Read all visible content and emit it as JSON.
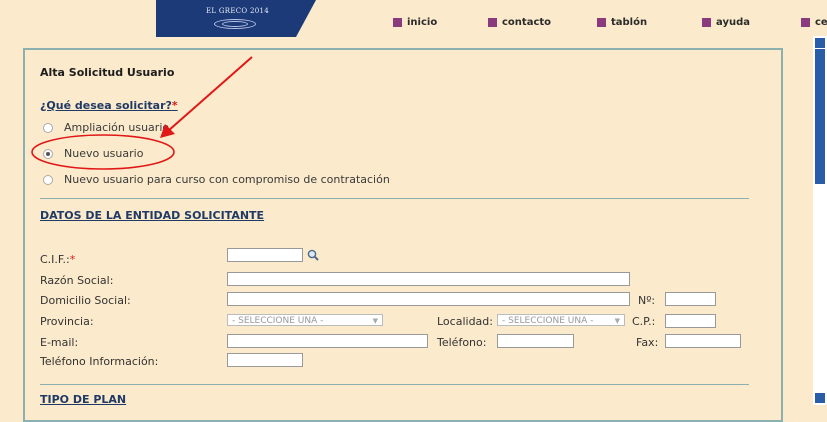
{
  "logo": {
    "text": "EL GRECO 2014"
  },
  "nav": {
    "items": [
      {
        "label": "inicio"
      },
      {
        "label": "contacto"
      },
      {
        "label": "tablón"
      },
      {
        "label": "ayuda"
      },
      {
        "label": "ce"
      }
    ]
  },
  "form": {
    "title": "Alta Solicitud Usuario",
    "question": "¿Qué desea solicitar?",
    "required_mark": "*",
    "options": [
      {
        "label": "Ampliación usuario",
        "selected": false
      },
      {
        "label": "Nuevo usuario",
        "selected": true
      },
      {
        "label": "Nuevo usuario para curso con compromiso de contratación",
        "selected": false
      }
    ],
    "section_entity": "DATOS DE LA ENTIDAD SOLICITANTE",
    "fields": {
      "cif": "C.I.F.:",
      "razon": "Razón Social:",
      "domicilio": "Domicilio Social:",
      "numero": "Nº:",
      "provincia": "Provincia:",
      "provincia_value": "- SELECCIONE UNA -",
      "localidad": "Localidad:",
      "localidad_value": "- SELECCIONE UNA -",
      "cp": "C.P.:",
      "email": "E-mail:",
      "telefono": "Teléfono:",
      "fax": "Fax:",
      "telefono_info": "Teléfono Información:"
    },
    "section_plan": "TIPO DE PLAN"
  },
  "colors": {
    "annotation": "#e01818",
    "nav_square": "#8a3b7d",
    "logo_band": "#1c3a78",
    "scrollbar": "#2a5da8"
  }
}
